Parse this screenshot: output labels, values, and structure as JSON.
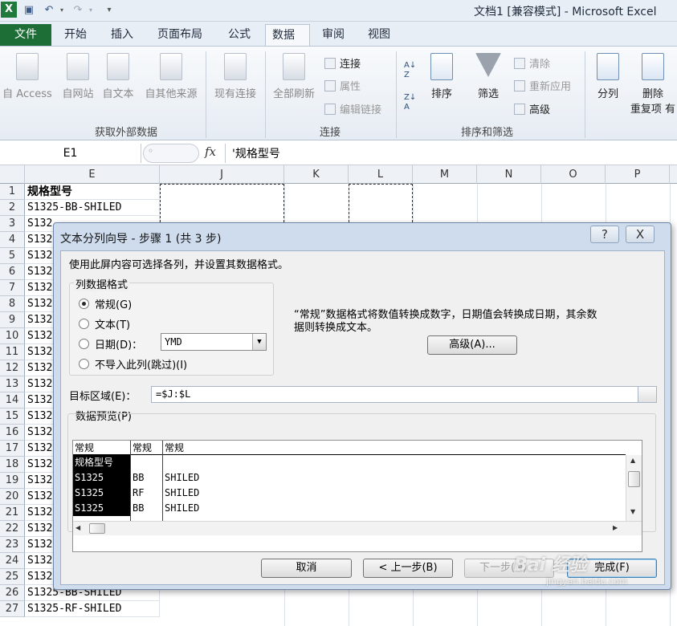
{
  "window": {
    "title": "文档1  [兼容模式] - Microsoft Excel",
    "app_icon": "X",
    "quick_access": [
      "save-icon",
      "undo-icon",
      "redo-icon",
      "customize-icon"
    ]
  },
  "ribbon": {
    "tabs": [
      "文件",
      "开始",
      "插入",
      "页面布局",
      "公式",
      "数据",
      "审阅",
      "视图"
    ],
    "active_tab": "数据",
    "groups": {
      "external": {
        "label": "获取外部数据",
        "buttons": [
          "自 Access",
          "自网站",
          "自文本",
          "自其他来源",
          "现有连接"
        ]
      },
      "connections": {
        "label": "连接",
        "refresh_all": "全部刷新",
        "connect": "连接",
        "properties": "属性",
        "edit_links": "编辑链接"
      },
      "sort_filter": {
        "label": "排序和筛选",
        "sort": "排序",
        "filter": "筛选",
        "clear": "清除",
        "reapply": "重新应用",
        "advanced": "高级"
      },
      "tools": {
        "text_to_columns": "分列",
        "remove_duplicates_1": "删除",
        "remove_duplicates_2": "重复项 有"
      }
    }
  },
  "formula_bar": {
    "name_box": "E1",
    "fx": "fx",
    "value": "'规格型号"
  },
  "grid": {
    "columns": [
      "E",
      "J",
      "K",
      "L",
      "M",
      "N",
      "O",
      "P"
    ],
    "rows": [
      "1",
      "2",
      "3",
      "4",
      "5",
      "6",
      "7",
      "8",
      "9",
      "10",
      "11",
      "12",
      "13",
      "14",
      "15",
      "16",
      "17",
      "18",
      "19",
      "20",
      "21",
      "22",
      "23",
      "24",
      "25",
      "26",
      "27"
    ],
    "e_cells": [
      "规格型号",
      "S1325-BB-SHILED",
      "S132",
      "S132",
      "S132",
      "S132",
      "S132",
      "S132",
      "S132",
      "S132",
      "S132",
      "S132",
      "S132",
      "S132",
      "S132",
      "S132",
      "S132",
      "S132",
      "S132",
      "S132",
      "S132",
      "S132",
      "S132",
      "S132",
      "S1325-RF-SHILED",
      "S1325-BB-SHILED",
      "S1325-RF-SHILED"
    ]
  },
  "dialog": {
    "title": "文本分列向导 - 步骤 1 (共 3 步)",
    "help": "?",
    "close": "X",
    "intro": "使用此屏内容可选择各列，并设置其数据格式。",
    "format_group_label": "列数据格式",
    "radio_general": "常规(G)",
    "radio_text": "文本(T)",
    "radio_date": "日期(D)：",
    "radio_skip": "不导入此列(跳过)(I)",
    "date_value": "YMD",
    "desc_line1": "“常规”数据格式将数值转换成数字，日期值会转换成日期，其余数",
    "desc_line2": "据则转换成文本。",
    "advanced_button": "高级(A)...",
    "dest_label": "目标区域(E)：",
    "dest_value": "=$J:$L",
    "preview_label": "数据预览(P)",
    "preview": {
      "headers": [
        "常规",
        "常规",
        "常规"
      ],
      "rows": [
        [
          "规格型号",
          "",
          ""
        ],
        [
          "S1325",
          "BB",
          "SHILED"
        ],
        [
          "S1325",
          "RF",
          "SHILED"
        ],
        [
          "S1325",
          "BB",
          "SHILED"
        ]
      ]
    },
    "buttons": {
      "cancel": "取消",
      "back": "< 上一步(B)",
      "next": "下一步(N) >",
      "finish": "完成(F)"
    }
  },
  "watermark": {
    "brand": "Bai 经验",
    "url": "jingyan.baidu.com"
  }
}
